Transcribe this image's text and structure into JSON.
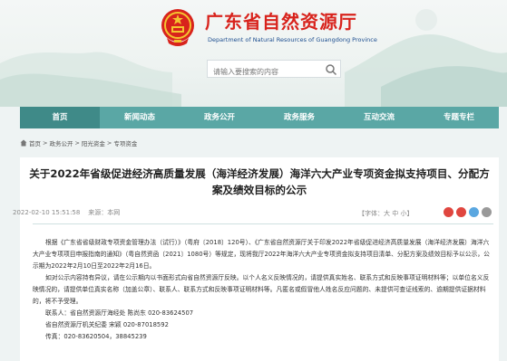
{
  "header": {
    "title": "广东省自然资源厅",
    "subtitle": "Department of Natural Resources of Guangdong Province",
    "search_placeholder": "请输入要搜索的内容"
  },
  "nav": {
    "items": [
      {
        "label": "首页"
      },
      {
        "label": "新闻动态"
      },
      {
        "label": "政务公开"
      },
      {
        "label": "政务服务"
      },
      {
        "label": "互动交流"
      },
      {
        "label": "专题专栏"
      }
    ]
  },
  "breadcrumb": {
    "items": [
      "首页",
      "政务公开",
      "阳光资金",
      "专项资金"
    ],
    "separator": ">"
  },
  "article": {
    "title_line1": "关于2022年省级促进经济高质量发展（海洋经济发展）海洋六大产业专项资金拟支持项目、分配方",
    "title_line2": "案及绩效目标的公示",
    "date": "2022-02-10 15:51:58",
    "source": "来源：本网",
    "font_label": "【字体：",
    "font_large": "大",
    "font_medium": "中",
    "font_small": "小",
    "font_close": "】",
    "para1": "根据《广东省省级财政专项资金管理办法（试行）》（粤府〔2018〕120号）、《广东省自然资源厅关于印发2022年省级促进经济高质量发展（海洋经济发展）海洋六大产业专项项目申报指南的通知》（粤自然资函〔2021〕1080号）等规定，现将我厅2022年海洋六大产业专项资金拟支持项目清单、分配方案及绩效目标予以公示，公示期为2022年2月10日至2022年2月16日。",
    "para2": "如对公示内容持有异议，请在公示期内以书面形式向省自然资源厅反映。以个人名义反映情况的，请提供真实姓名、联系方式和反映事项证明材料等；以单位名义反映情况的，请提供单位真实名称（加盖公章）、联系人、联系方式和反映事项证明材料等。凡匿名或假冒他人姓名反应问题的、未提供可查证线索的、逾期提供证据材料的，将不予受理。",
    "contact1": "联系人：省自然资源厅海经处 陈尚东 020-83624507",
    "contact2": "省自然资源厅机关纪委 宋颖 020-87018592",
    "contact3": "传真：020-83620504，38845239"
  },
  "colors": {
    "nav_bg": "#5aa7a5",
    "nav_active": "#3f8a88",
    "title_red": "#d8231c",
    "subtitle_blue": "#1c4d8f"
  }
}
